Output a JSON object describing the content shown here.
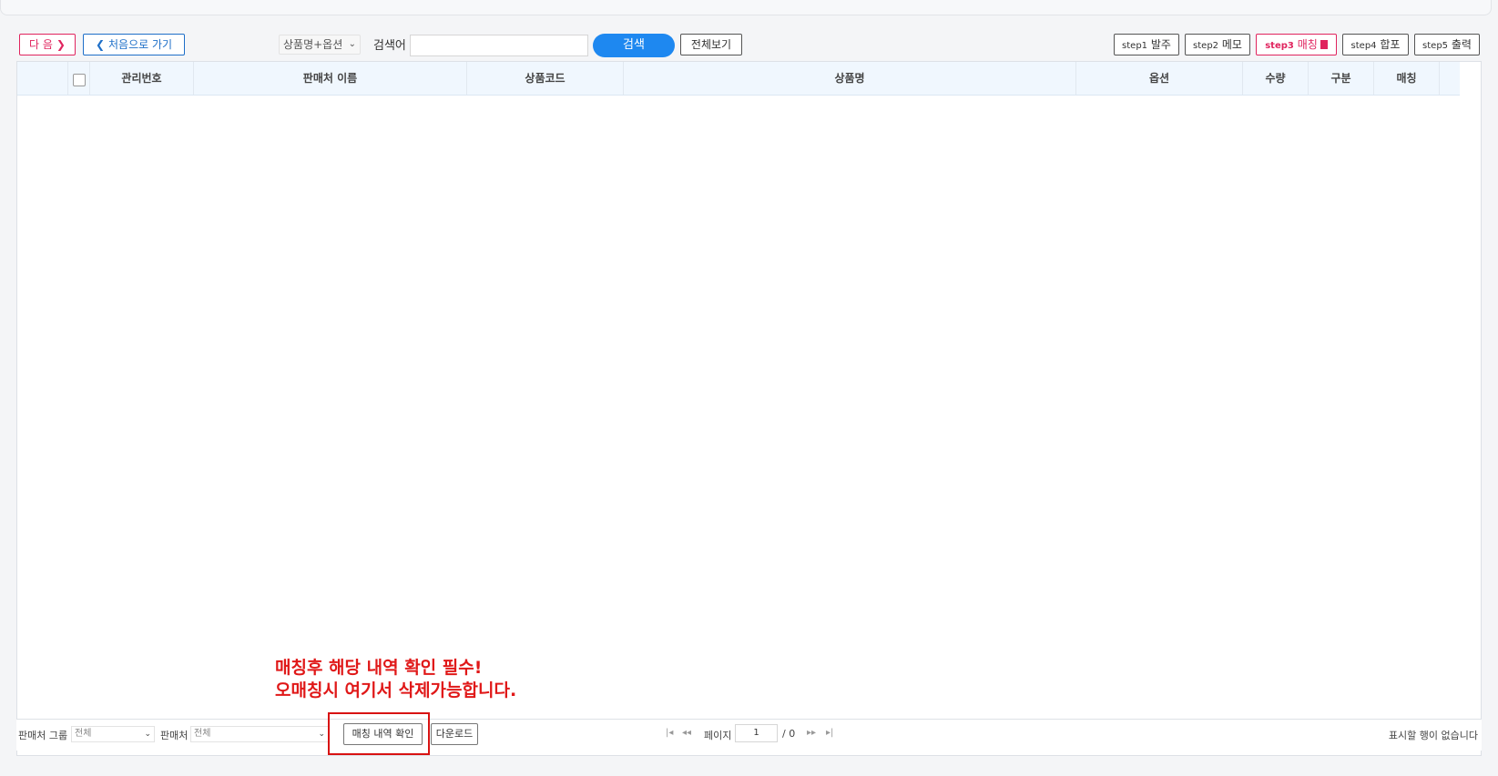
{
  "toolbar": {
    "next_label": "다 음",
    "home_label": "처음으로 가기",
    "search_type": "상품명+옵션",
    "search_label": "검색어",
    "search_value": "",
    "search_button": "검색",
    "view_all_button": "전체보기",
    "steps": [
      {
        "prefix": "step1",
        "label": "발주"
      },
      {
        "prefix": "step2",
        "label": "메모"
      },
      {
        "prefix": "step3",
        "label": "매칭"
      },
      {
        "prefix": "step4",
        "label": "합포"
      },
      {
        "prefix": "step5",
        "label": "출력"
      }
    ]
  },
  "grid": {
    "columns": [
      "관리번호",
      "판매처 이름",
      "상품코드",
      "상품명",
      "옵션",
      "수량",
      "구분",
      "매칭"
    ],
    "rows": []
  },
  "callout": {
    "line1": "매칭후 해당 내역 확인 필수!",
    "line2": "오매칭시 여기서 삭제가능합니다."
  },
  "footer": {
    "seller_group_label": "판매처 그룹",
    "seller_group_value": "전체",
    "seller_label": "판매처",
    "seller_value": "전체",
    "check_matching_button": "매칭 내역 확인",
    "download_button": "다운로드",
    "page_label": "페이지",
    "page_current": "1",
    "page_total": "/ 0",
    "empty_message": "표시할 행이 없습니다"
  },
  "colors": {
    "accent_red": "#e0245e",
    "accent_blue": "#1e6fc8",
    "search_button": "#1e88f0",
    "callout_red": "#e01818"
  }
}
